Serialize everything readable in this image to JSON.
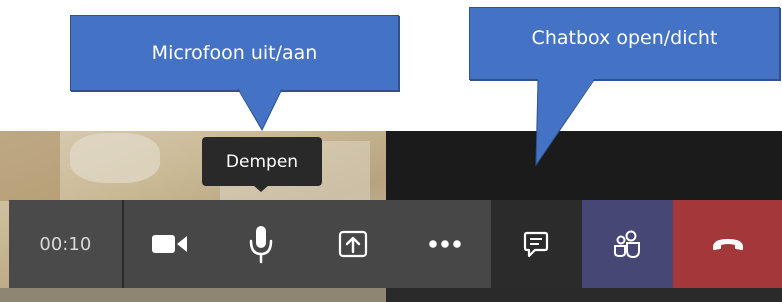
{
  "callouts": {
    "mic": "Microfoon uit/aan",
    "chat": "Chatbox open/dicht"
  },
  "tooltip": {
    "label": "Dempen"
  },
  "toolbar": {
    "timer": "00:10",
    "buttons": [
      {
        "id": "camera",
        "icon": "video-camera-icon"
      },
      {
        "id": "mic",
        "icon": "microphone-icon"
      },
      {
        "id": "share",
        "icon": "share-screen-icon"
      },
      {
        "id": "more",
        "icon": "more-options-icon"
      },
      {
        "id": "chat",
        "icon": "chat-icon"
      },
      {
        "id": "participants",
        "icon": "participants-icon"
      },
      {
        "id": "hangup",
        "icon": "hang-up-icon"
      }
    ]
  },
  "colors": {
    "callout": "#4472c4",
    "toolbar": "#474747",
    "participants_active": "#464775",
    "hangup": "#a4373a"
  }
}
